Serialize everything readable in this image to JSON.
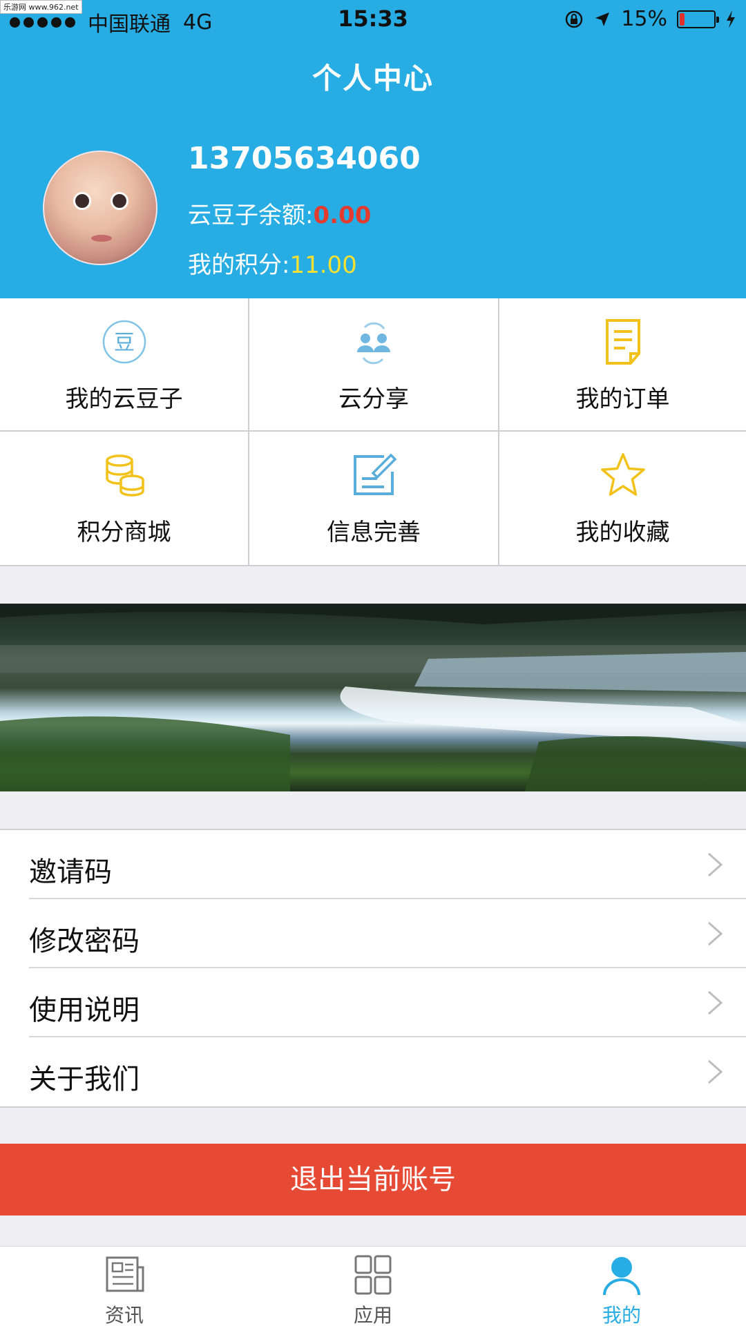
{
  "watermark": "乐游网 www.962.net",
  "status_bar": {
    "carrier": "中国联通",
    "network": "4G",
    "time": "15:33",
    "battery": "15%",
    "battery_level": 0.15,
    "battery_color": "#e0312d"
  },
  "header": {
    "title": "个人中心",
    "phone": "13705634060",
    "balance_label": "云豆子余额:",
    "balance_value": "0.00",
    "points_label": "我的积分:",
    "points_value": "11.00"
  },
  "grid": [
    {
      "label": "我的云豆子",
      "icon": "bean-icon",
      "icon_text": "豆"
    },
    {
      "label": "云分享",
      "icon": "share-users-icon"
    },
    {
      "label": "我的订单",
      "icon": "order-document-icon"
    },
    {
      "label": "积分商城",
      "icon": "coins-icon"
    },
    {
      "label": "信息完善",
      "icon": "edit-info-icon"
    },
    {
      "label": "我的收藏",
      "icon": "star-icon"
    }
  ],
  "menu": [
    {
      "label": "邀请码"
    },
    {
      "label": "修改密码"
    },
    {
      "label": "使用说明"
    },
    {
      "label": "关于我们"
    }
  ],
  "logout_label": "退出当前账号",
  "tabs": [
    {
      "label": "资讯",
      "icon": "news-icon"
    },
    {
      "label": "应用",
      "icon": "apps-grid-icon"
    },
    {
      "label": "我的",
      "icon": "user-icon",
      "active": true
    }
  ],
  "colors": {
    "header_bg": "#27ace3",
    "balance": "#e33c2f",
    "points": "#f8e12f",
    "logout": "#e64a35",
    "active_tab": "#27ace3"
  }
}
